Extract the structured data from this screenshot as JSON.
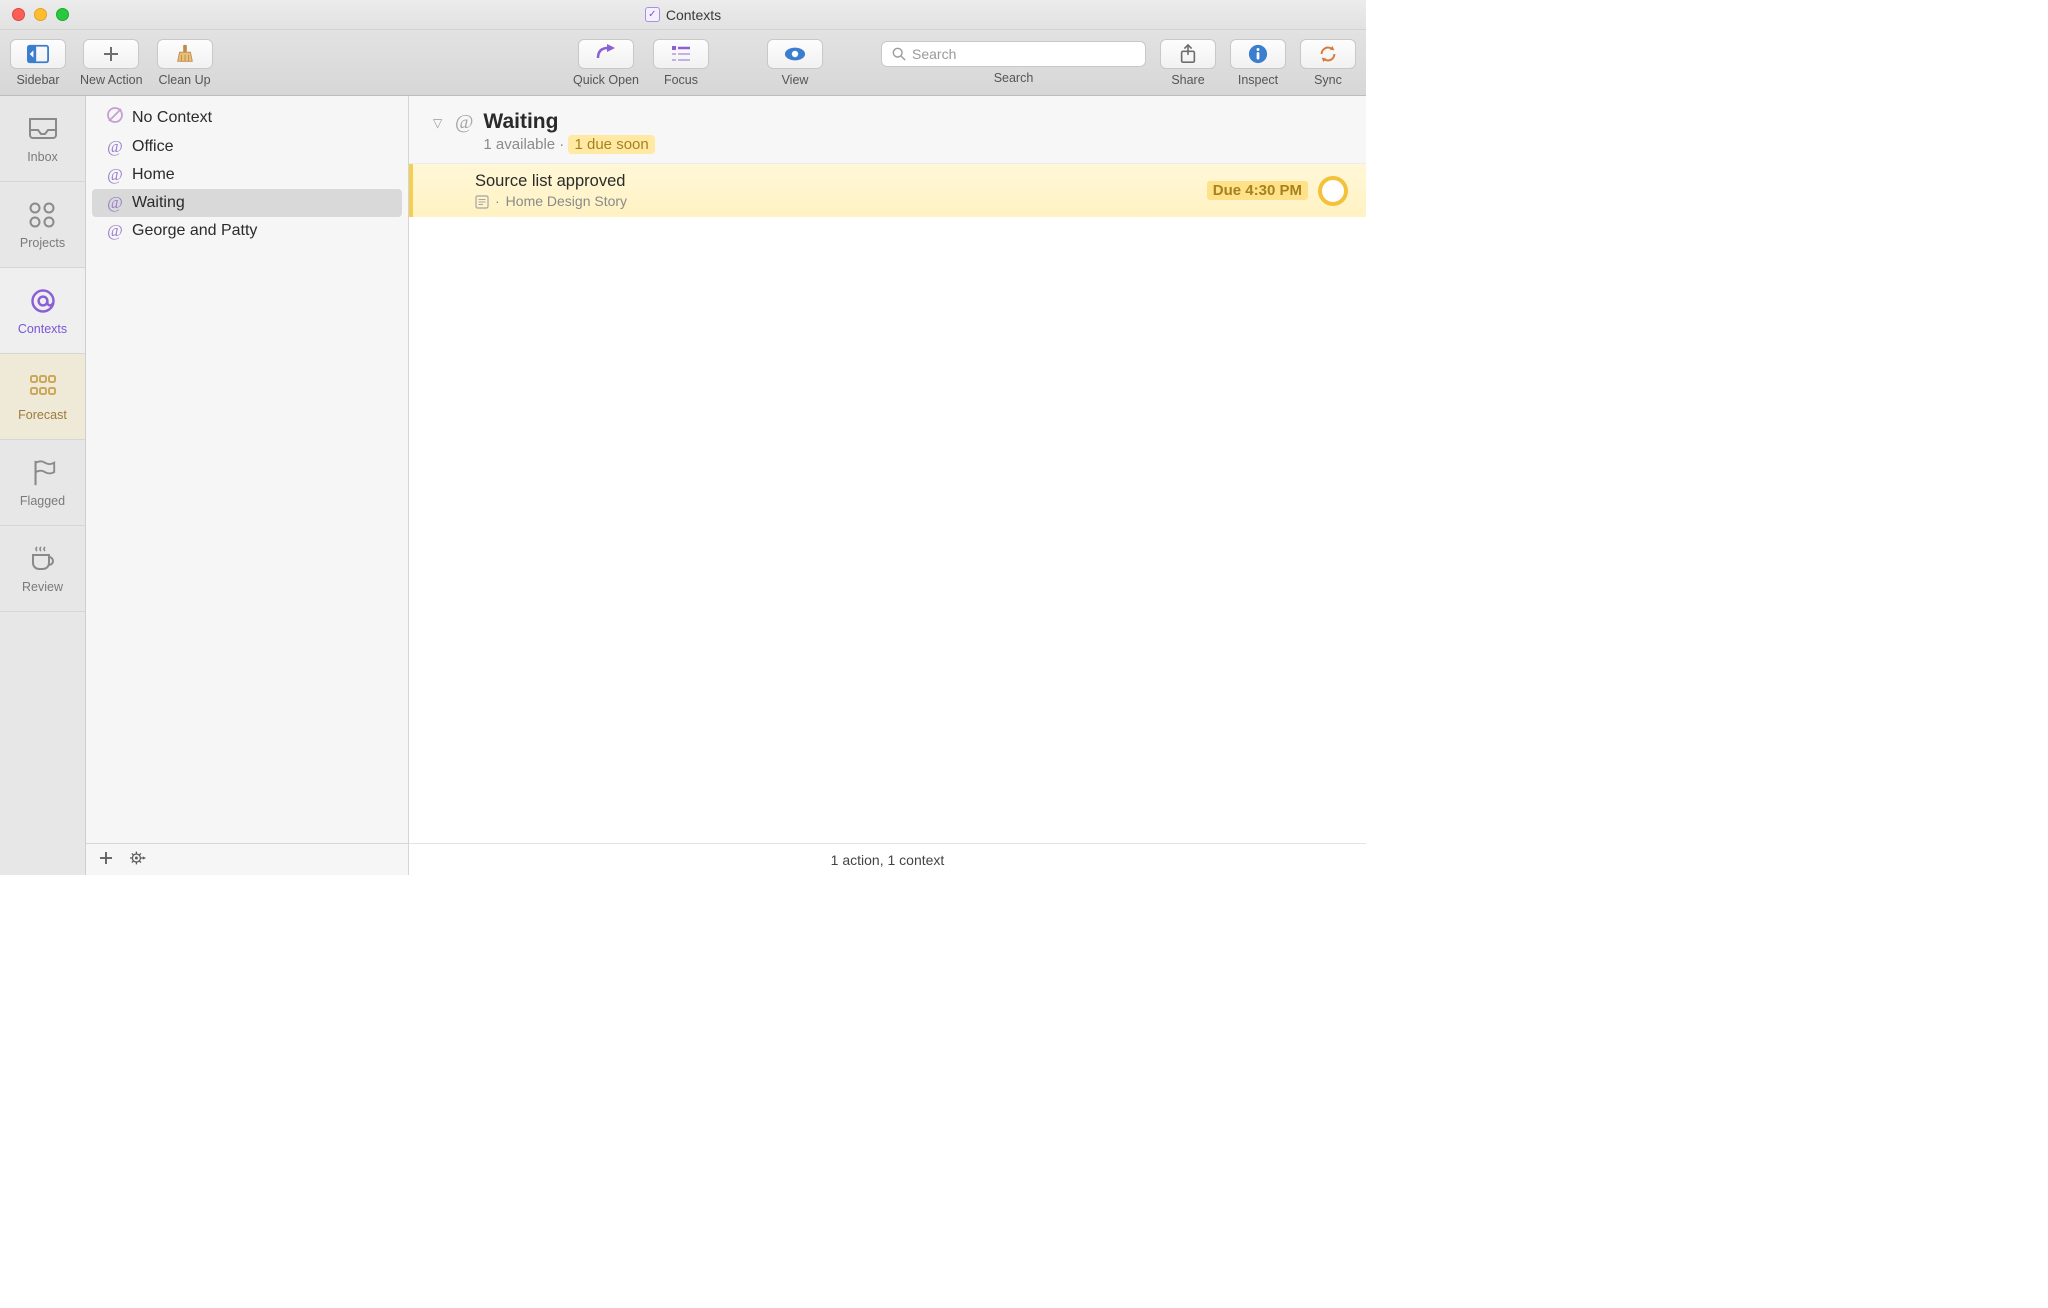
{
  "window": {
    "title": "Contexts"
  },
  "toolbar": {
    "sidebar": "Sidebar",
    "new_action": "New Action",
    "clean_up": "Clean Up",
    "quick_open": "Quick Open",
    "focus": "Focus",
    "view": "View",
    "share": "Share",
    "inspect": "Inspect",
    "sync": "Sync",
    "search_label": "Search",
    "search_placeholder": "Search"
  },
  "tabs": [
    {
      "id": "inbox",
      "label": "Inbox"
    },
    {
      "id": "projects",
      "label": "Projects"
    },
    {
      "id": "contexts",
      "label": "Contexts"
    },
    {
      "id": "forecast",
      "label": "Forecast"
    },
    {
      "id": "flagged",
      "label": "Flagged"
    },
    {
      "id": "review",
      "label": "Review"
    }
  ],
  "contexts": {
    "items": [
      {
        "label": "No Context"
      },
      {
        "label": "Office"
      },
      {
        "label": "Home"
      },
      {
        "label": "Waiting"
      },
      {
        "label": "George and Patty"
      }
    ]
  },
  "header": {
    "title": "Waiting",
    "available": "1 available",
    "sep": " · ",
    "due_soon": "1 due soon"
  },
  "tasks": [
    {
      "title": "Source list approved",
      "project": "Home Design Story",
      "due_label": "Due 4:30 PM"
    }
  ],
  "status": "1 action, 1 context"
}
